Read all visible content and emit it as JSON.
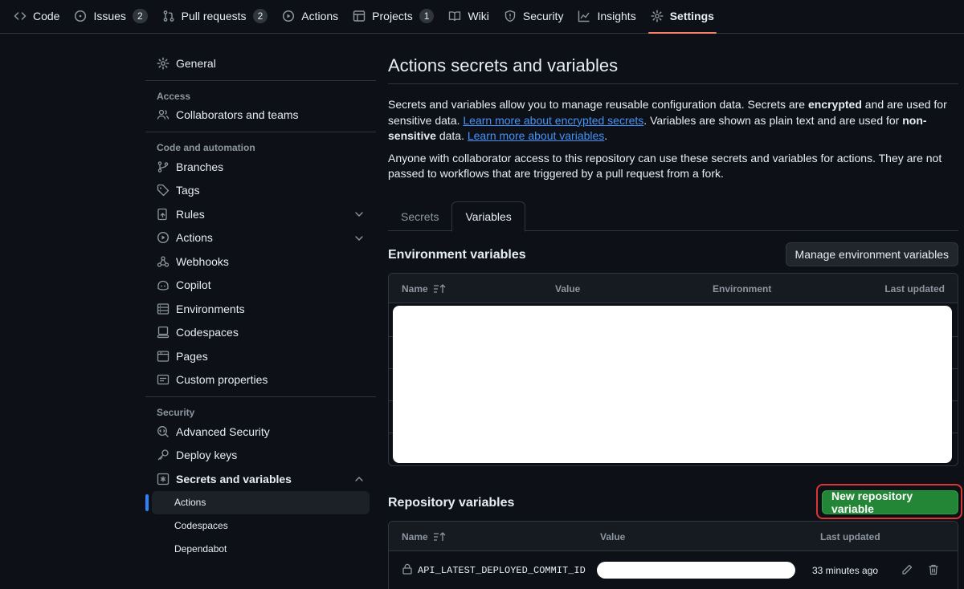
{
  "repo_tabs": [
    {
      "label": "Code",
      "icon": "code-icon"
    },
    {
      "label": "Issues",
      "icon": "issue-opened-icon",
      "count": "2"
    },
    {
      "label": "Pull requests",
      "icon": "git-pull-request-icon",
      "count": "2"
    },
    {
      "label": "Actions",
      "icon": "play-icon"
    },
    {
      "label": "Projects",
      "icon": "table-icon",
      "count": "1"
    },
    {
      "label": "Wiki",
      "icon": "book-icon"
    },
    {
      "label": "Security",
      "icon": "shield-icon"
    },
    {
      "label": "Insights",
      "icon": "graph-icon"
    },
    {
      "label": "Settings",
      "icon": "gear-icon",
      "selected": true
    }
  ],
  "sidebar": {
    "general": "General",
    "access_heading": "Access",
    "collaborators": "Collaborators and teams",
    "code_heading": "Code and automation",
    "code_items": [
      "Branches",
      "Tags",
      "Rules",
      "Actions",
      "Webhooks",
      "Copilot",
      "Environments",
      "Codespaces",
      "Pages",
      "Custom properties"
    ],
    "security_heading": "Security",
    "security_items": [
      "Advanced Security",
      "Deploy keys",
      "Secrets and variables"
    ],
    "secrets_sub": [
      "Actions",
      "Codespaces",
      "Dependabot"
    ]
  },
  "main": {
    "title": "Actions secrets and variables",
    "desc1_a": "Secrets and variables allow you to manage reusable configuration data. Secrets are ",
    "desc1_b": "encrypted",
    "desc1_c": " and are used for sensitive data. ",
    "desc1_link1": "Learn more about encrypted secrets",
    "desc1_d": ". Variables are shown as plain text and are used for ",
    "desc1_e": "non-sensitive",
    "desc1_f": " data. ",
    "desc1_link2": "Learn more about variables",
    "desc1_g": ".",
    "desc2": "Anyone with collaborator access to this repository can use these secrets and variables for actions. They are not passed to workflows that are triggered by a pull request from a fork.",
    "tabs": [
      "Secrets",
      "Variables"
    ],
    "env_title": "Environment variables",
    "env_button": "Manage environment variables",
    "env_cols": [
      "Name",
      "Value",
      "Environment",
      "Last updated"
    ],
    "repo_title": "Repository variables",
    "repo_button": "New repository variable",
    "repo_cols": [
      "Name",
      "Value",
      "Last updated"
    ],
    "repo_rows": [
      {
        "name": "API_LATEST_DEPLOYED_COMMIT_ID",
        "updated": "33 minutes ago"
      }
    ]
  }
}
